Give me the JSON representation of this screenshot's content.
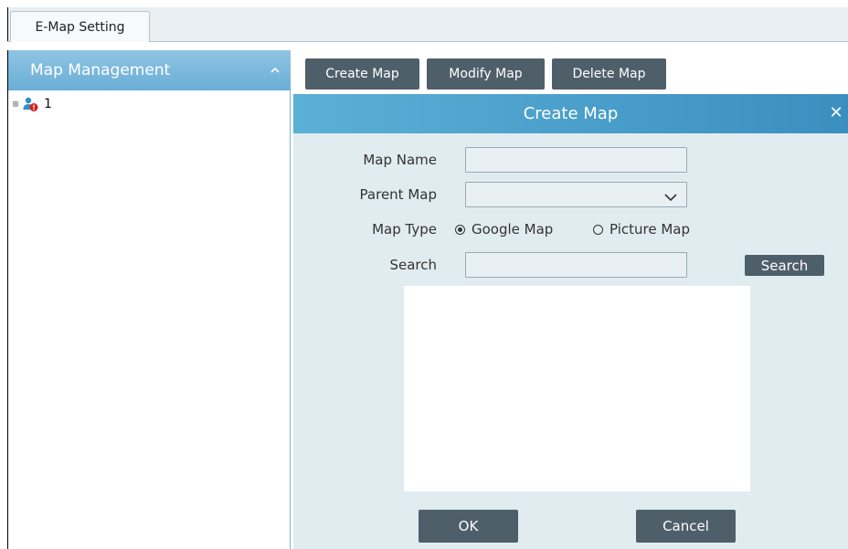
{
  "tabs": [
    {
      "label": "E-Map Setting",
      "active": true
    }
  ],
  "sidebar": {
    "title": "Map Management",
    "collapse_icon": "chevron-up-icon",
    "tree": [
      {
        "label": "1",
        "icon": "map-pin-alert-icon",
        "expander": "⊞"
      }
    ]
  },
  "toolbar": {
    "create_label": "Create Map",
    "modify_label": "Modify Map",
    "delete_label": "Delete Map"
  },
  "dialog": {
    "title": "Create Map",
    "close_glyph": "✕",
    "fields": {
      "map_name": {
        "label": "Map Name",
        "value": ""
      },
      "parent_map": {
        "label": "Parent Map",
        "value": ""
      },
      "map_type": {
        "label": "Map Type",
        "options": [
          {
            "label": "Google Map",
            "selected": true
          },
          {
            "label": "Picture Map",
            "selected": false
          }
        ]
      },
      "search": {
        "label": "Search",
        "value": "",
        "button_label": "Search"
      }
    },
    "ok_label": "OK",
    "cancel_label": "Cancel"
  },
  "colors": {
    "header_blue": "#6aaed6",
    "dialog_bg": "#e1ecf1",
    "button_dark": "#4f5f6a"
  }
}
